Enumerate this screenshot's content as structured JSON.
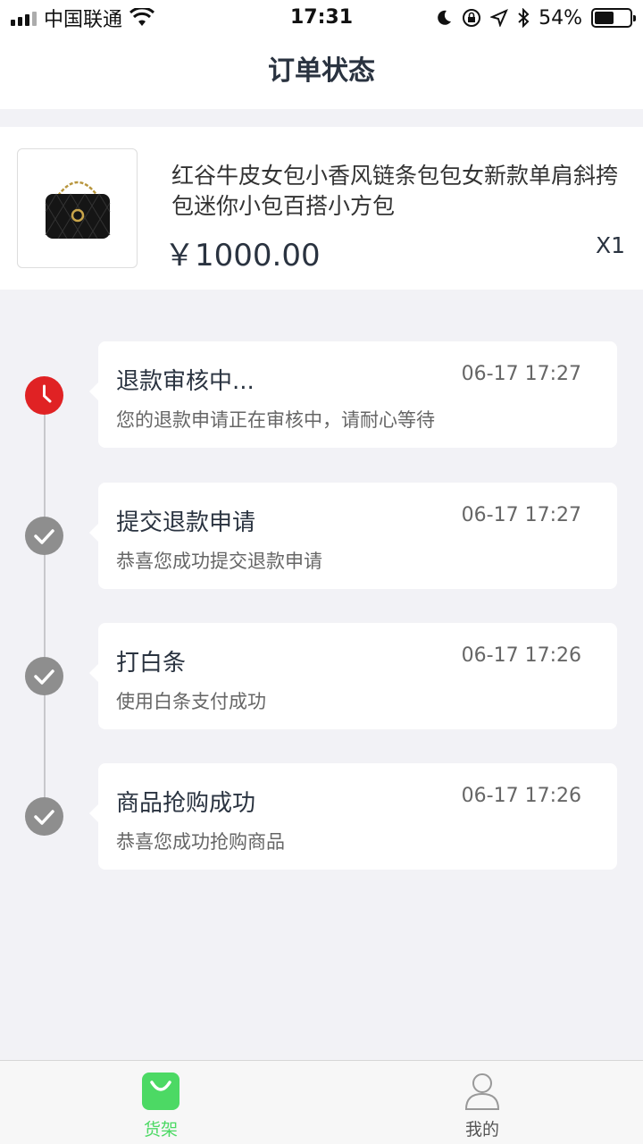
{
  "status_bar": {
    "carrier": "中国联通",
    "time": "17:31",
    "battery": "54%",
    "battery_level": 0.54
  },
  "nav": {
    "title": "订单状态"
  },
  "product": {
    "title": "红谷牛皮女包小香风链条包包女新款单肩斜挎包迷你小包百搭小方包",
    "price": "￥1000.00",
    "quantity": "X1",
    "image_icon": "handbag-image"
  },
  "timeline": [
    {
      "title": "退款审核中...",
      "time": "06-17 17:27",
      "desc": "您的退款申请正在审核中，请耐心等待",
      "status": "pending",
      "icon": "clock-icon"
    },
    {
      "title": "提交退款申请",
      "time": "06-17 17:27",
      "desc": "恭喜您成功提交退款申请",
      "status": "done",
      "icon": "check-icon"
    },
    {
      "title": "打白条",
      "time": "06-17 17:26",
      "desc": "使用白条支付成功",
      "status": "done",
      "icon": "check-icon"
    },
    {
      "title": "商品抢购成功",
      "time": "06-17 17:26",
      "desc": "恭喜您成功抢购商品",
      "status": "done",
      "icon": "check-icon"
    }
  ],
  "tab_bar": {
    "tabs": [
      {
        "label": "货架",
        "icon": "shopping-bag-icon",
        "active": true
      },
      {
        "label": "我的",
        "icon": "user-icon",
        "active": false
      }
    ],
    "active_color": "#4cd964",
    "inactive_color": "#555555"
  }
}
